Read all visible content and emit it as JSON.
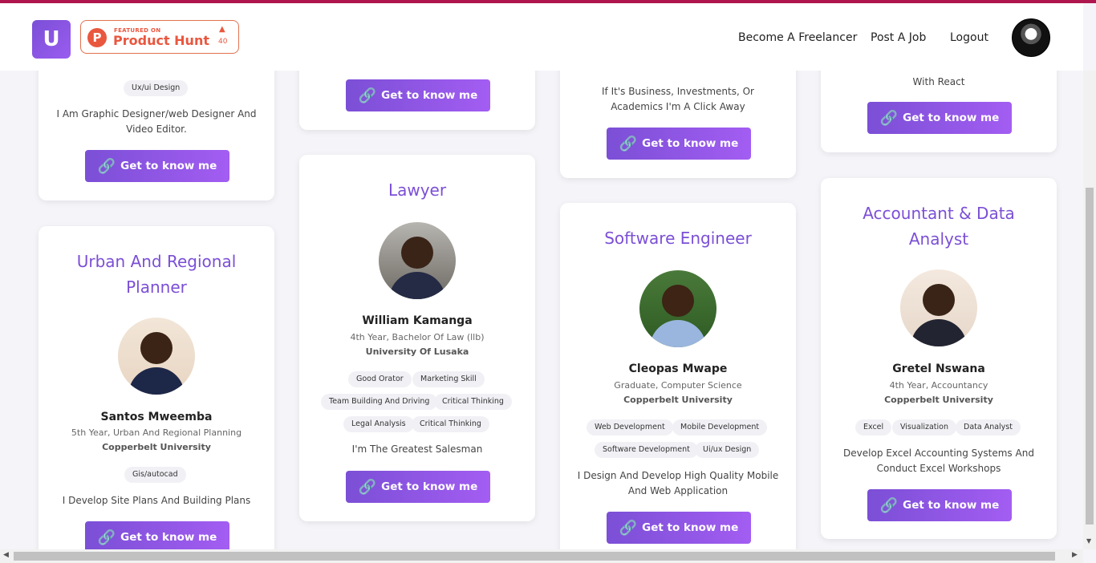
{
  "navbar": {
    "logo_letter": "U",
    "product_hunt": {
      "featured": "FEATURED ON",
      "name": "Product Hunt",
      "arrow": "▲",
      "count": "40",
      "initial": "P"
    },
    "links": [
      "Become A Freelancer",
      "Post A Job",
      "Logout"
    ]
  },
  "button_label": "Get to know me",
  "link_icon": "🔗",
  "cards": {
    "c1": {
      "tags": [
        "Ux/ui Design"
      ],
      "bio": "I Am Graphic Designer/web Designer And Video Editor."
    },
    "c2": {},
    "c3": {
      "bio": "If It's Business, Investments, Or Academics I'm A Click Away"
    },
    "c4": {
      "bio": "With React"
    },
    "c5": {
      "title": "Urban And Regional Planner",
      "name": "Santos Mweemba",
      "year": "5th Year, Urban And Regional Planning",
      "uni": "Copperbelt University",
      "tags": [
        "Gis/autocad"
      ],
      "bio": "I Develop Site Plans And Building Plans"
    },
    "c6": {
      "title": "Lawyer",
      "name": "William Kamanga",
      "year": "4th Year, Bachelor Of Law (llb)",
      "uni": "University Of Lusaka",
      "tags": [
        "Good Orator",
        "Marketing Skill",
        "Team Building And Driving",
        "Critical Thinking",
        "Legal Analysis",
        "Critical Thinking"
      ],
      "bio": "I'm The Greatest Salesman"
    },
    "c7": {
      "title": "Software Engineer",
      "name": "Cleopas Mwape",
      "year": "Graduate, Computer Science",
      "uni": "Copperbelt University",
      "tags": [
        "Web Development",
        "Mobile Development",
        "Software Development",
        "Ui/ux Design"
      ],
      "bio": "I Design And Develop High Quality Mobile And Web Application"
    },
    "c8": {
      "title": "Accountant & Data Analyst",
      "name": "Gretel Nswana",
      "year": "4th Year, Accountancy",
      "uni": "Copperbelt University",
      "tags": [
        "Excel",
        "Visualization",
        "Data Analyst"
      ],
      "bio": "Develop Excel Accounting Systems And Conduct Excel Workshops"
    }
  },
  "scroll": {
    "up": "▲",
    "down": "▼",
    "left": "◀",
    "right": "▶"
  }
}
